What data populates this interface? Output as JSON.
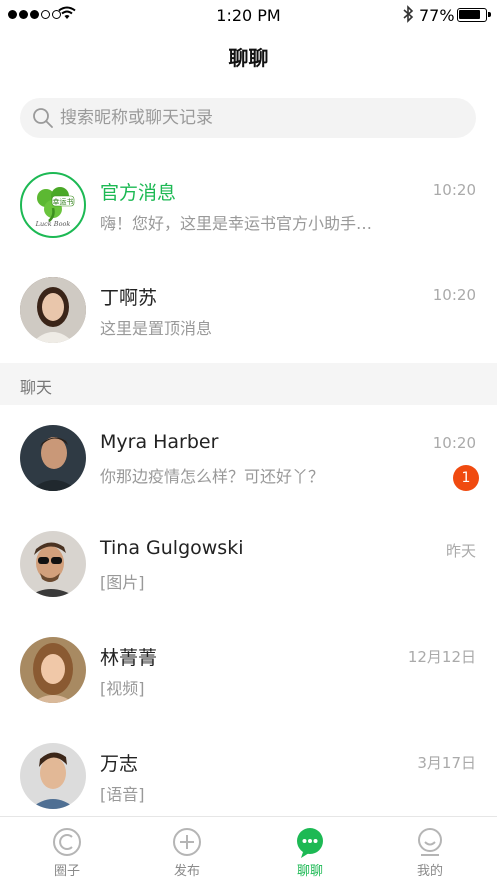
{
  "status_bar": {
    "time": "1:20 PM",
    "battery": "77%",
    "battery_level": 0.77,
    "signal_bars_filled": 3,
    "signal_bars_total": 5
  },
  "header": {
    "title": "聊聊"
  },
  "search": {
    "placeholder": "搜索昵称或聊天记录",
    "icon": "search-icon"
  },
  "pinned": [
    {
      "name": "官方消息",
      "preview": "嗨！您好，这里是幸运书官方小助手…",
      "time": "10:20",
      "highlight_color": "#1db954",
      "logo_text": "幸运书",
      "logo_subtext": "Luck Book"
    },
    {
      "name": "丁啊苏",
      "preview": "这里是置顶消息",
      "time": "10:20"
    }
  ],
  "section": {
    "label": "聊天"
  },
  "chats": [
    {
      "name": "Myra Harber",
      "preview": "你那边疫情怎么样？可还好丫？",
      "time": "10:20",
      "unread": "1"
    },
    {
      "name": "Tina Gulgowski",
      "preview": "[图片]",
      "time": "昨天"
    },
    {
      "name": "林菁菁",
      "preview": "[视频]",
      "time": "12月12日"
    },
    {
      "name": "万志",
      "preview": "[语音]",
      "time": "3月17日"
    }
  ],
  "tabs": [
    {
      "label": "圈子",
      "icon": "circle-c-icon",
      "active": false
    },
    {
      "label": "发布",
      "icon": "plus-circle-icon",
      "active": false
    },
    {
      "label": "聊聊",
      "icon": "chat-bubble-icon",
      "active": true
    },
    {
      "label": "我的",
      "icon": "person-icon",
      "active": false
    }
  ],
  "colors": {
    "accent": "#1db954",
    "badge": "#f04a10"
  }
}
